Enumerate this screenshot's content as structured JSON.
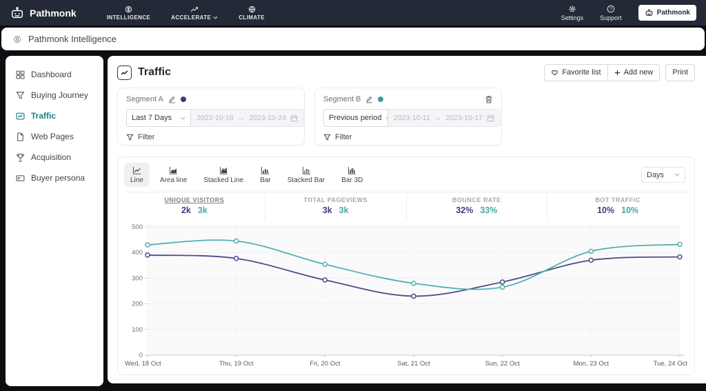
{
  "topnav": {
    "brand": "Pathmonk",
    "items": [
      {
        "label": "INTELLIGENCE"
      },
      {
        "label": "ACCELERATE",
        "has_dropdown": true
      },
      {
        "label": "CLIMATE"
      }
    ],
    "settings_label": "Settings",
    "support_label": "Support",
    "account_button": "Pathmonk"
  },
  "breadcrumb": {
    "label": "Pathmonk Intelligence"
  },
  "sidebar": {
    "items": [
      {
        "label": "Dashboard",
        "active": false
      },
      {
        "label": "Buying Journey",
        "active": false
      },
      {
        "label": "Traffic",
        "active": true
      },
      {
        "label": "Web Pages",
        "active": false
      },
      {
        "label": "Acquisition",
        "active": false
      },
      {
        "label": "Buyer persona",
        "active": false
      }
    ]
  },
  "header": {
    "title": "Traffic",
    "favorite_label": "Favorite list",
    "add_new_label": "Add new",
    "print_label": "Print"
  },
  "segments": [
    {
      "name": "Segment A",
      "color": "#3e3a75",
      "range_type": "Last 7 Days",
      "date_start": "2023-10-18",
      "date_arrow": "→",
      "date_end": "2023-10-24",
      "filter_label": "Filter"
    },
    {
      "name": "Segment B",
      "color": "#3f9b98",
      "range_type": "Previous period",
      "date_start": "2023-10-11",
      "date_arrow": "→",
      "date_end": "2023-10-17",
      "filter_label": "Filter"
    }
  ],
  "chart_controls": {
    "types": [
      {
        "label": "Line",
        "active": true
      },
      {
        "label": "Area line",
        "active": false
      },
      {
        "label": "Stacked Line",
        "active": false
      },
      {
        "label": "Bar",
        "active": false
      },
      {
        "label": "Stacked Bar",
        "active": false
      },
      {
        "label": "Bar 3D",
        "active": false
      }
    ],
    "interval": "Days"
  },
  "stats": [
    {
      "label": "UNIQUE VISITORS",
      "a": "2k",
      "b": "3k",
      "active": true
    },
    {
      "label": "TOTAL PAGEVIEWS",
      "a": "3k",
      "b": "3k",
      "active": false
    },
    {
      "label": "BOUNCE RATE",
      "a": "32%",
      "b": "33%",
      "active": false
    },
    {
      "label": "BOT TRAFFIC",
      "a": "10%",
      "b": "10%",
      "active": false
    }
  ],
  "chart_data": {
    "type": "line",
    "title": "Unique visitors per day, Segment A vs Segment B",
    "categories": [
      "Wed, 18 Oct",
      "Thu, 19 Oct",
      "Fri, 20 Oct",
      "Sat, 21 Oct",
      "Sun, 22 Oct",
      "Mon, 23 Oct",
      "Tue, 24 Oct"
    ],
    "series": [
      {
        "name": "Segment A",
        "color": "#4d4a8a",
        "values": [
          390,
          377,
          293,
          230,
          285,
          370,
          383
        ]
      },
      {
        "name": "Segment B",
        "color": "#54b0ad",
        "values": [
          430,
          445,
          354,
          280,
          265,
          405,
          432
        ]
      }
    ],
    "xlabel": "",
    "ylabel": "",
    "ylim": [
      0,
      500
    ],
    "yticks": [
      0,
      100,
      200,
      300,
      400,
      500
    ],
    "grid": true,
    "legend": "none",
    "smooth": true
  },
  "colors": {
    "topbar_bg": "#232936",
    "active_nav_teal": "#1e7e84",
    "segment_a": "#4d4a8a",
    "segment_b": "#54b0ad",
    "stat_value_a": "#403c7c",
    "stat_value_b": "#48a8a5"
  }
}
